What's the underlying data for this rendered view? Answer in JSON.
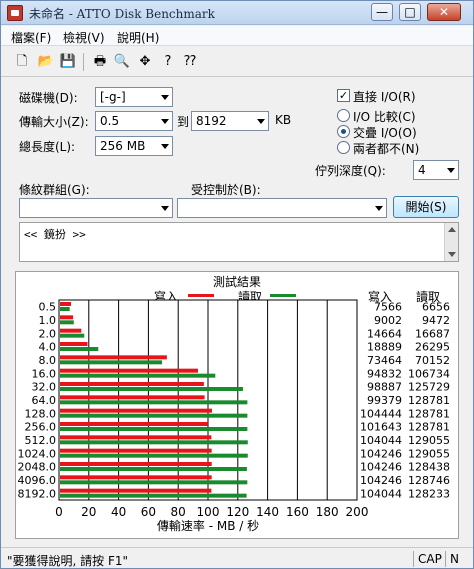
{
  "window": {
    "title": "未命名 - ATTO Disk Benchmark",
    "minimize": "—",
    "maximize": "□",
    "close": "✕"
  },
  "menu": [
    "檔案(F)",
    "檢視(V)",
    "說明(H)"
  ],
  "toolbar": {
    "icons": [
      "new-file-icon",
      "open-folder-icon",
      "save-icon",
      "print-icon",
      "print-preview-icon",
      "move-icon",
      "help-icon",
      "context-help-icon"
    ],
    "glyphs": [
      "🗋",
      "📂",
      "💾",
      "🖶",
      "🔍",
      "✥",
      "?",
      "⁇"
    ]
  },
  "settings": {
    "drive_label": "磁碟機(D):",
    "drive_value": "[-g-]",
    "transfer_label": "傳輸大小(Z):",
    "transfer_from": "0.5",
    "to_label": "到",
    "transfer_to": "8192",
    "unit": "KB",
    "length_label": "總長度(L):",
    "length_value": "256 MB",
    "direct_io_label": "直接 I/O(R)",
    "direct_io_checked": "✓",
    "io_compare_label": "I/O 比較(C)",
    "overlap_io_label": "交疊 I/O(O)",
    "neither_label": "兩者都不(N)",
    "queue_label": "佇列深度(Q):",
    "queue_value": "4",
    "pattern_label": "條紋群組(G):",
    "control_label": "受控制於(B):",
    "start_button": "開始(S)",
    "log_text": "<< 鏡扮 >>"
  },
  "results": {
    "title": "測試結果",
    "write_label": "寫入",
    "read_label": "讀取",
    "col_write": "寫入",
    "col_read": "讀取",
    "write_color": "#e8141c",
    "read_color": "#1a8a2e"
  },
  "chart_data": {
    "type": "bar",
    "orientation": "horizontal",
    "categories": [
      "0.5",
      "1.0",
      "2.0",
      "4.0",
      "8.0",
      "16.0",
      "32.0",
      "64.0",
      "128.0",
      "256.0",
      "512.0",
      "1024.0",
      "2048.0",
      "4096.0",
      "8192.0"
    ],
    "series": [
      {
        "name": "寫入",
        "values": [
          7566,
          9002,
          14664,
          18889,
          73464,
          94832,
          98887,
          99379,
          104444,
          101643,
          104044,
          104246,
          104246,
          104246,
          104044
        ]
      },
      {
        "name": "讀取",
        "values": [
          6656,
          9472,
          16687,
          26295,
          70152,
          106734,
          125729,
          128781,
          128781,
          128781,
          129055,
          129055,
          128438,
          128746,
          128233
        ]
      }
    ],
    "write_display": [
      "7566",
      "9002",
      "14664",
      "18889",
      "73464",
      "94832",
      "98887",
      "99379",
      "104444",
      "101643",
      "104044",
      "104246",
      "104246",
      "104246",
      "104044"
    ],
    "read_display": [
      "6656",
      "9472",
      "16687",
      "26295",
      "70152",
      "106734",
      "125729",
      "128781",
      "128781",
      "128781",
      "129055",
      "129055",
      "128438",
      "128746",
      "128233"
    ],
    "xlabel": "傳輸速率 - MB / 秒",
    "xlim": [
      0,
      200
    ],
    "xticks": [
      "0",
      "20",
      "40",
      "60",
      "80",
      "100",
      "120",
      "140",
      "160",
      "180",
      "200"
    ],
    "grid": true
  },
  "status": {
    "help": "\"要獲得說明, 請按 F1\"",
    "cap": "CAP",
    "num": "N"
  }
}
